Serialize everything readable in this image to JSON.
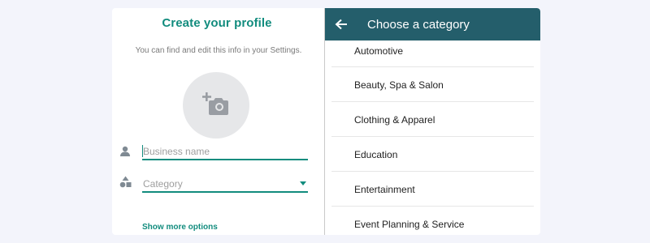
{
  "profile": {
    "title": "Create your profile",
    "subtitle": "You can find and edit this info in your Settings.",
    "business_name_placeholder": "Business name",
    "category_placeholder": "Category",
    "show_more": "Show more options"
  },
  "category_panel": {
    "title": "Choose a category",
    "items": [
      "Automotive",
      "Beauty, Spa & Salon",
      "Clothing & Apparel",
      "Education",
      "Entertainment",
      "Event Planning & Service"
    ]
  },
  "colors": {
    "accent": "#128c7e",
    "header": "#245e6b",
    "background": "#f3f4fb"
  }
}
